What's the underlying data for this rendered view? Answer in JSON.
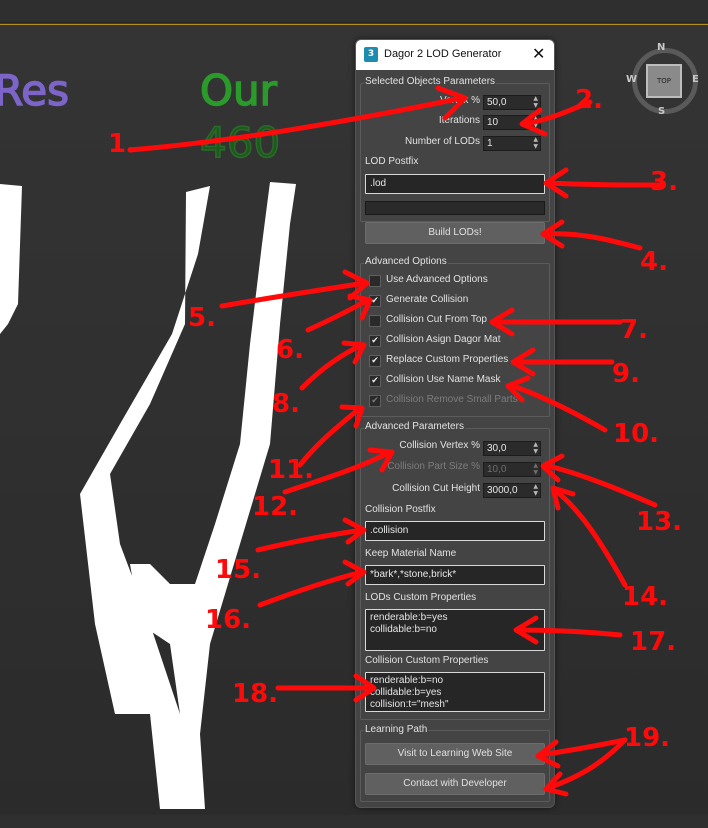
{
  "window": {
    "title": "Dagor 2 LOD Generator",
    "app_icon": "3",
    "close": "✕"
  },
  "viewport": {
    "texts": [
      "Res",
      "Our",
      "460"
    ],
    "navcube": {
      "face": "TOP",
      "n": "N",
      "s": "S",
      "w": "W",
      "e": "E"
    }
  },
  "selected": {
    "header": "Selected Objects Parameters",
    "vertex_label": "Vertex %",
    "vertex_value": "50,0",
    "iterations_label": "Iterations",
    "iterations_value": "10",
    "lods_label": "Number of LODs",
    "lods_value": "1",
    "postfix_label": "LOD Postfix",
    "postfix_value": ".lod",
    "progress": 0,
    "build_button": "Build LODs!"
  },
  "advanced_options": {
    "header": "Advanced Options",
    "items": [
      {
        "label": "Use Advanced Options",
        "checked": false,
        "enabled": true
      },
      {
        "label": "Generate Collision",
        "checked": true,
        "enabled": true
      },
      {
        "label": "Collision Cut From Top",
        "checked": false,
        "enabled": true
      },
      {
        "label": "Collision Asign Dagor Mat",
        "checked": true,
        "enabled": true
      },
      {
        "label": "Replace Custom Properties",
        "checked": true,
        "enabled": true
      },
      {
        "label": "Collision Use Name Mask",
        "checked": true,
        "enabled": true
      },
      {
        "label": "Collision Remove Small Parts",
        "checked": true,
        "enabled": false
      }
    ]
  },
  "advanced_params": {
    "header": "Advanced Parameters",
    "cvertex_label": "Collision Vertex %",
    "cvertex_value": "30,0",
    "partsize_label": "Collision Part Size %",
    "partsize_value": "10,0",
    "cutheight_label": "Collision Cut Height",
    "cutheight_value": "3000,0",
    "cpostfix_label": "Collision Postfix",
    "cpostfix_value": ".collision",
    "keepmat_label": "Keep Material Name",
    "keepmat_value": "*bark*,*stone,brick*",
    "lodprops_label": "LODs Custom Properties",
    "lodprops_lines": [
      "renderable:b=yes",
      "collidable:b=no"
    ],
    "colprops_label": "Collision Custom Properties",
    "colprops_lines": [
      "renderable:b=no",
      "collidable:b=yes",
      "collision:t=\"mesh\""
    ]
  },
  "learning": {
    "header": "Learning Path",
    "web_button": "Visit to Learning Web Site",
    "dev_button": "Contact with Developer"
  },
  "annotations": {
    "color": "#ff0a0a",
    "labels": [
      "1.",
      "2.",
      "3.",
      "4.",
      "5.",
      "6.",
      "7.",
      "8.",
      "9.",
      "10.",
      "11.",
      "12.",
      "13.",
      "14.",
      "15.",
      "16.",
      "17.",
      "18.",
      "19."
    ]
  }
}
